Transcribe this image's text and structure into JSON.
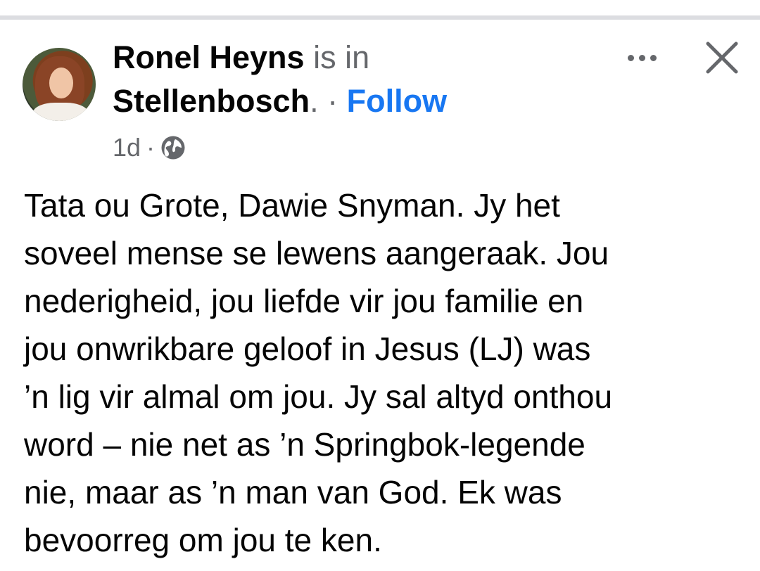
{
  "post": {
    "author": "Ronel Heyns",
    "is_in": "is in",
    "location": "Stellenbosch",
    "location_suffix": ".",
    "separator": "·",
    "follow_label": "Follow",
    "timestamp": "1d",
    "meta_separator": "·",
    "privacy_icon": "globe-icon",
    "more_icon": "more-options-icon",
    "close_icon": "close-icon",
    "body": "Tata ou Grote, Dawie Snyman. Jy het\nsoveel mense se lewens aangeraak. Jou\nnederigheid, jou liefde vir jou familie en\njou onwrikbare geloof in Jesus (LJ) was\n’n lig vir almal om jou. Jy sal altyd onthou\nword – nie net as ’n Springbok-legende\nnie, maar as ’n man van God. Ek was\nbevoorreg om jou te ken."
  },
  "colors": {
    "text": "#050505",
    "secondary": "#65676b",
    "link": "#1877f2",
    "divider": "#dcdde1"
  }
}
